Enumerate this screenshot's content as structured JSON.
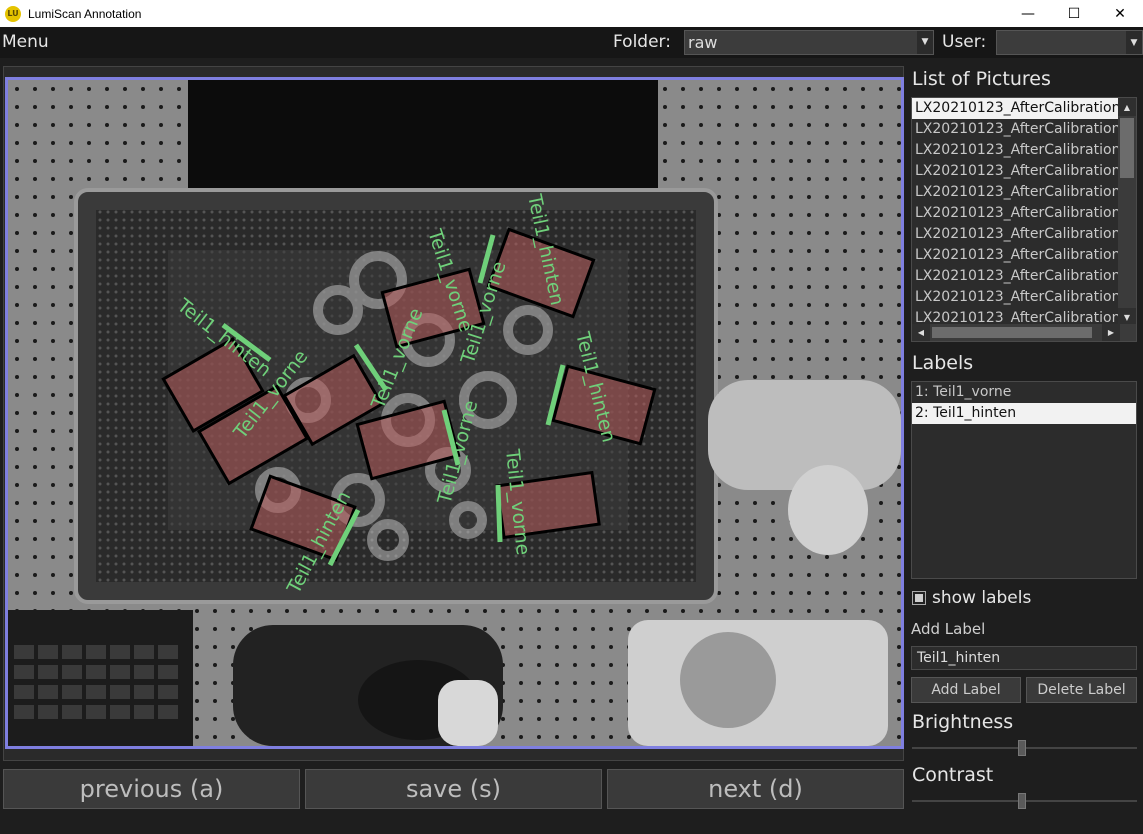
{
  "window": {
    "title": "LumiScan Annotation",
    "icon_text": "LU",
    "minimize": "—",
    "maximize": "☐",
    "close": "✕"
  },
  "topbar": {
    "menu": "Menu",
    "folder_label": "Folder:",
    "folder_value": "raw",
    "user_label": "User:",
    "user_value": "",
    "dropdown_arrow": "▼"
  },
  "pictures": {
    "title": "List of Pictures",
    "items": [
      "LX20210123_AfterCalibration",
      "LX20210123_AfterCalibration",
      "LX20210123_AfterCalibration",
      "LX20210123_AfterCalibration",
      "LX20210123_AfterCalibration",
      "LX20210123_AfterCalibration",
      "LX20210123_AfterCalibration",
      "LX20210123_AfterCalibration",
      "LX20210123_AfterCalibration",
      "LX20210123_AfterCalibration",
      "LX20210123_AfterCalibration"
    ],
    "selected_index": 0
  },
  "labels": {
    "title": "Labels",
    "items": [
      "1: Teil1_vorne",
      "2: Teil1_hinten"
    ],
    "selected_index": 1
  },
  "controls": {
    "show_labels": "show labels",
    "show_labels_checked": true,
    "add_label_title": "Add Label",
    "add_label_value": "Teil1_hinten",
    "add_label_button": "Add Label",
    "delete_label_button": "Delete Label",
    "brightness": "Brightness",
    "brightness_level": 0.5,
    "contrast": "Contrast",
    "contrast_level": 0.5
  },
  "navigation": {
    "previous": "previous (a)",
    "save": "save (s)",
    "next": "next (d)"
  },
  "annotations": [
    {
      "text": "Teil1_hinten",
      "class": "Teil1_hinten"
    },
    {
      "text": "Teil1_vorne",
      "class": "Teil1_vorne"
    },
    {
      "text": "Teil1_vorne",
      "class": "Teil1_vorne"
    },
    {
      "text": "Teil1_vorne",
      "class": "Teil1_vorne"
    },
    {
      "text": "Teil1_vorne",
      "class": "Teil1_vorne"
    },
    {
      "text": "Teil1_hinten",
      "class": "Teil1_hinten"
    },
    {
      "text": "Teil1_vorne",
      "class": "Teil1_vorne"
    },
    {
      "text": "Teil1_hinten",
      "class": "Teil1_hinten"
    },
    {
      "text": "Teil1_vorne",
      "class": "Teil1_vorne"
    },
    {
      "text": "Teil1_hinten",
      "class": "Teil1_hinten"
    }
  ],
  "colors": {
    "annotation_text": "#6fd07a",
    "box_fill": "#b45a5a",
    "image_border": "#7f7fe0"
  }
}
